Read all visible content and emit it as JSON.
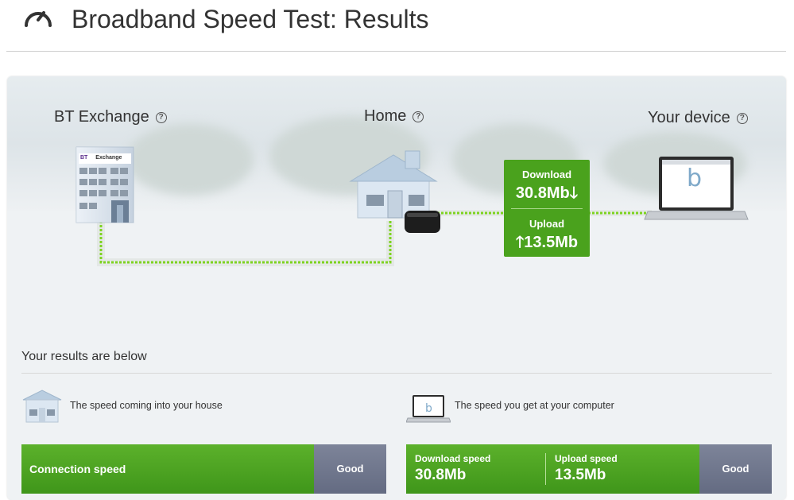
{
  "header": {
    "title": "Broadband Speed Test: Results",
    "icon": "speedometer-icon"
  },
  "diagram": {
    "exchange_label": "BT Exchange",
    "home_label": "Home",
    "device_label": "Your device",
    "help_icon_glyph": "?",
    "exchange_sign_brand": "BT",
    "exchange_sign_text": "Exchange",
    "device_screen_logo": "b",
    "speed_box": {
      "download_label": "Download",
      "download_value": "30.8Mb",
      "download_arrow": "🡓",
      "upload_label": "Upload",
      "upload_value": "13.5Mb",
      "upload_arrow": "🡑"
    },
    "colors": {
      "accent_green": "#4aa21d",
      "grade_grey": "#6b7289"
    }
  },
  "results": {
    "heading": "Your results are below",
    "house_caption": "The speed coming into your house",
    "computer_caption": "The speed you get at your computer",
    "connection": {
      "label": "Connection speed",
      "grade": "Good"
    },
    "computer": {
      "download_label": "Download speed",
      "download_value": "30.8Mb",
      "upload_label": "Upload speed",
      "upload_value": "13.5Mb",
      "grade": "Good"
    }
  }
}
